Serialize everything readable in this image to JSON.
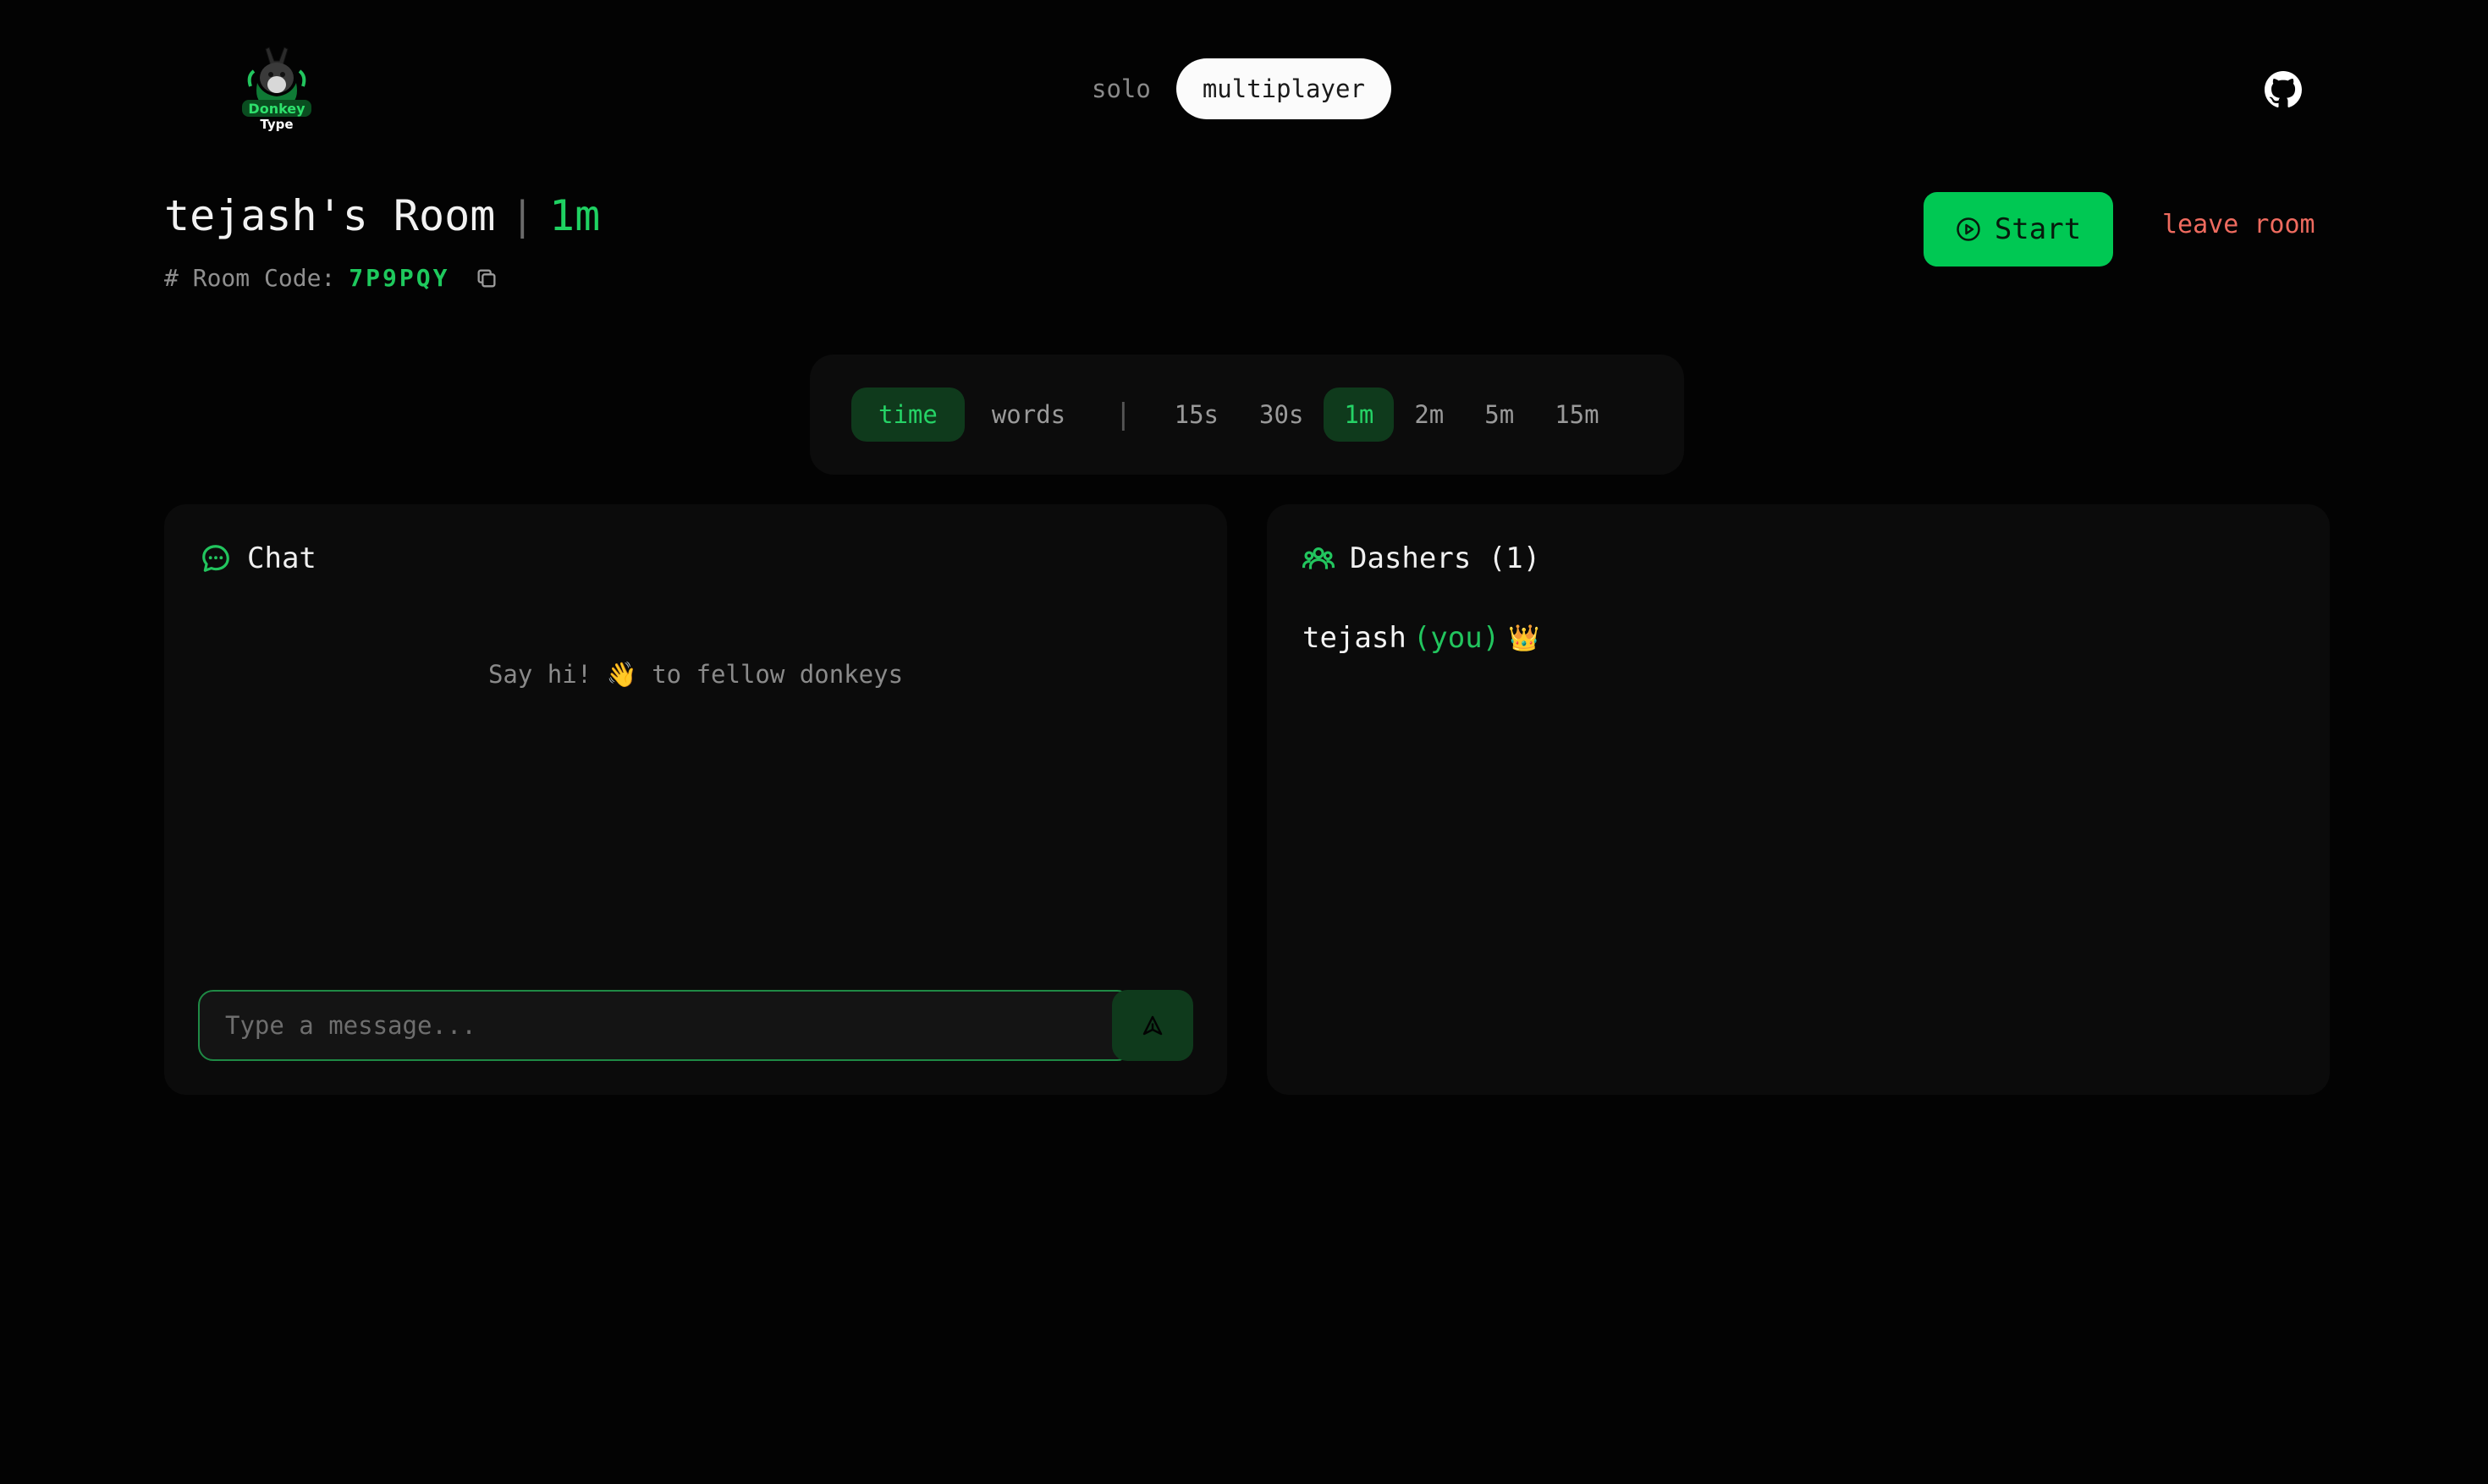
{
  "header": {
    "logo_text_line1": "Donkey",
    "logo_text_line2": "Type",
    "modes": {
      "solo": "solo",
      "multiplayer": "multiplayer",
      "active": "multiplayer"
    },
    "github_icon": "github-icon"
  },
  "room": {
    "title": "tejash's Room",
    "separator": "|",
    "duration": "1m",
    "code_label": "# Room Code:",
    "code": "7P9PQY",
    "start_label": "Start",
    "leave_label": "leave room"
  },
  "config": {
    "modes": [
      "time",
      "words"
    ],
    "active_mode": "time",
    "separator": "|",
    "durations": [
      "15s",
      "30s",
      "1m",
      "2m",
      "5m",
      "15m"
    ],
    "active_duration": "1m"
  },
  "chat": {
    "title": "Chat",
    "empty_text": "Say hi! 👋 to fellow donkeys",
    "input_placeholder": "Type a message...",
    "input_value": ""
  },
  "dashers": {
    "title": "Dashers (1)",
    "players": [
      {
        "name": "tejash",
        "tag": "(you)",
        "emoji": "👑"
      }
    ]
  },
  "colors": {
    "background": "#030303",
    "panel": "#0b0b0b",
    "accent": "#00c853",
    "accent_text": "#1fd162",
    "danger": "#ef6b5f"
  }
}
